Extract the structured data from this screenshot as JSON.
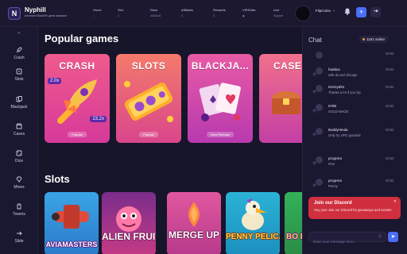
{
  "app": {
    "brand": "Nyphill",
    "tagline": "Advanced BlackFib game assistant",
    "logo_letter": "N"
  },
  "nav": [
    {
      "label": "Home",
      "sub": "⌂"
    },
    {
      "label": "Slot",
      "sub": "3"
    },
    {
      "label": "Race",
      "sub": "4d15h16"
    },
    {
      "label": "Affiliates",
      "sub": "3"
    },
    {
      "label": "Rewards",
      "sub": "3"
    },
    {
      "label": "VIP/Edits",
      "sub": "◆"
    },
    {
      "label": "Live",
      "sub": "Support"
    }
  ],
  "user": {
    "name": "FlipCoins"
  },
  "sidebar": {
    "items": [
      {
        "label": "Crash",
        "icon": "rocket-icon"
      },
      {
        "label": "Slots",
        "icon": "dice-icon"
      },
      {
        "label": "Blackjack",
        "icon": "cards-icon"
      },
      {
        "label": "Cases",
        "icon": "box-icon"
      },
      {
        "label": "Dice",
        "icon": "die-icon"
      },
      {
        "label": "Mines",
        "icon": "gem-icon"
      },
      {
        "label": "Towers",
        "icon": "tower-icon"
      },
      {
        "label": "Slide",
        "icon": "slide-icon"
      }
    ]
  },
  "popular": {
    "title": "Popular games",
    "cards": [
      {
        "title": "CRASH",
        "tag": "Popular",
        "mult_a": "2.0x",
        "mult_b": "23.2x",
        "color_top": "#ef5a8c",
        "color_bottom": "#d63a9a"
      },
      {
        "title": "SLOTS",
        "tag": "Popular",
        "color_top": "#f47a6b",
        "color_bottom": "#d9468c"
      },
      {
        "title": "BLACKJA...",
        "tag": "New Release",
        "color_top": "#e85aa4",
        "color_bottom": "#b83ab0"
      },
      {
        "title": "CASE",
        "tag": "",
        "color_top": "#f0708c",
        "color_bottom": "#c43fa4"
      }
    ]
  },
  "slots": {
    "title": "Slots",
    "games": [
      {
        "label": "AVIAMASTERS",
        "bg": "#2d8ed6"
      },
      {
        "label": "ALIEN FRUITS",
        "bg": "#b7308a"
      },
      {
        "label": "MERGE UP",
        "bg": "#d53b8a"
      },
      {
        "label": "PENNY PELICAN",
        "bg": "#1fa6d0"
      },
      {
        "label": "BO B",
        "bg": "#2e9c4a"
      }
    ]
  },
  "chat": {
    "title": "Chat",
    "online": "1151 online",
    "messages": [
      {
        "name": "",
        "text": "",
        "time": "03:52"
      },
      {
        "name": "haddus",
        "text": "velk do wid chicago",
        "time": "03:52"
      },
      {
        "name": "Kennyd91",
        "text": "Thanks a lot if you Gp",
        "time": "03:52"
      },
      {
        "name": "6788",
        "text": "GOLD MAGE",
        "time": "03:52"
      },
      {
        "name": "BuddyHeula",
        "text": "Only try UFO pyramid",
        "time": "03:52"
      },
      {
        "name": "progrera",
        "text": "Fine",
        "time": "03:52"
      },
      {
        "name": "progrera",
        "text": "Penny",
        "time": "03:52"
      }
    ],
    "discord": {
      "title": "Join our Discord",
      "text": "Hey you! Join our Discord for giveaways and events!"
    },
    "input_placeholder": "Enter your message here..."
  }
}
